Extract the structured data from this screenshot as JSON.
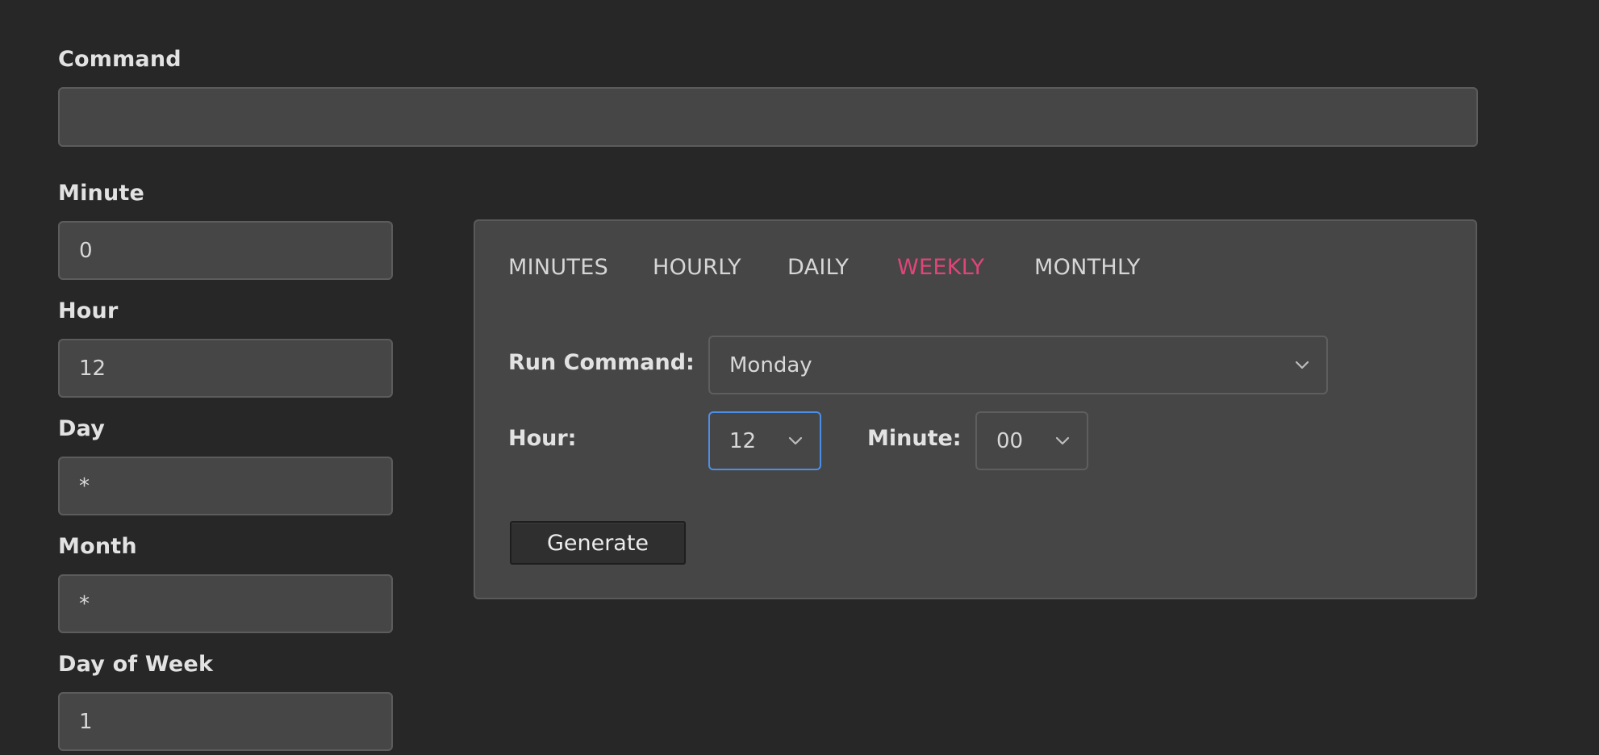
{
  "command": {
    "label": "Command",
    "value": ""
  },
  "cron_fields": [
    {
      "label": "Minute",
      "value": "0"
    },
    {
      "label": "Hour",
      "value": "12"
    },
    {
      "label": "Day",
      "value": "*"
    },
    {
      "label": "Month",
      "value": "*"
    },
    {
      "label": "Day of Week",
      "value": "1"
    }
  ],
  "tabs": [
    {
      "label": "MINUTES",
      "active": false
    },
    {
      "label": "HOURLY",
      "active": false
    },
    {
      "label": "DAILY",
      "active": false
    },
    {
      "label": "WEEKLY",
      "active": true
    },
    {
      "label": "MONTHLY",
      "active": false
    }
  ],
  "weekly": {
    "run_label": "Run Command:",
    "day_value": "Monday",
    "hour_label": "Hour:",
    "hour_value": "12",
    "minute_label": "Minute:",
    "minute_value": "00"
  },
  "generate_label": "Generate",
  "colors": {
    "background": "#272727",
    "panel": "#464646",
    "accent_tab": "#e0457a",
    "focus_border": "#4d8fe6"
  },
  "icons": {
    "dropdown": "chevron-down-icon"
  }
}
